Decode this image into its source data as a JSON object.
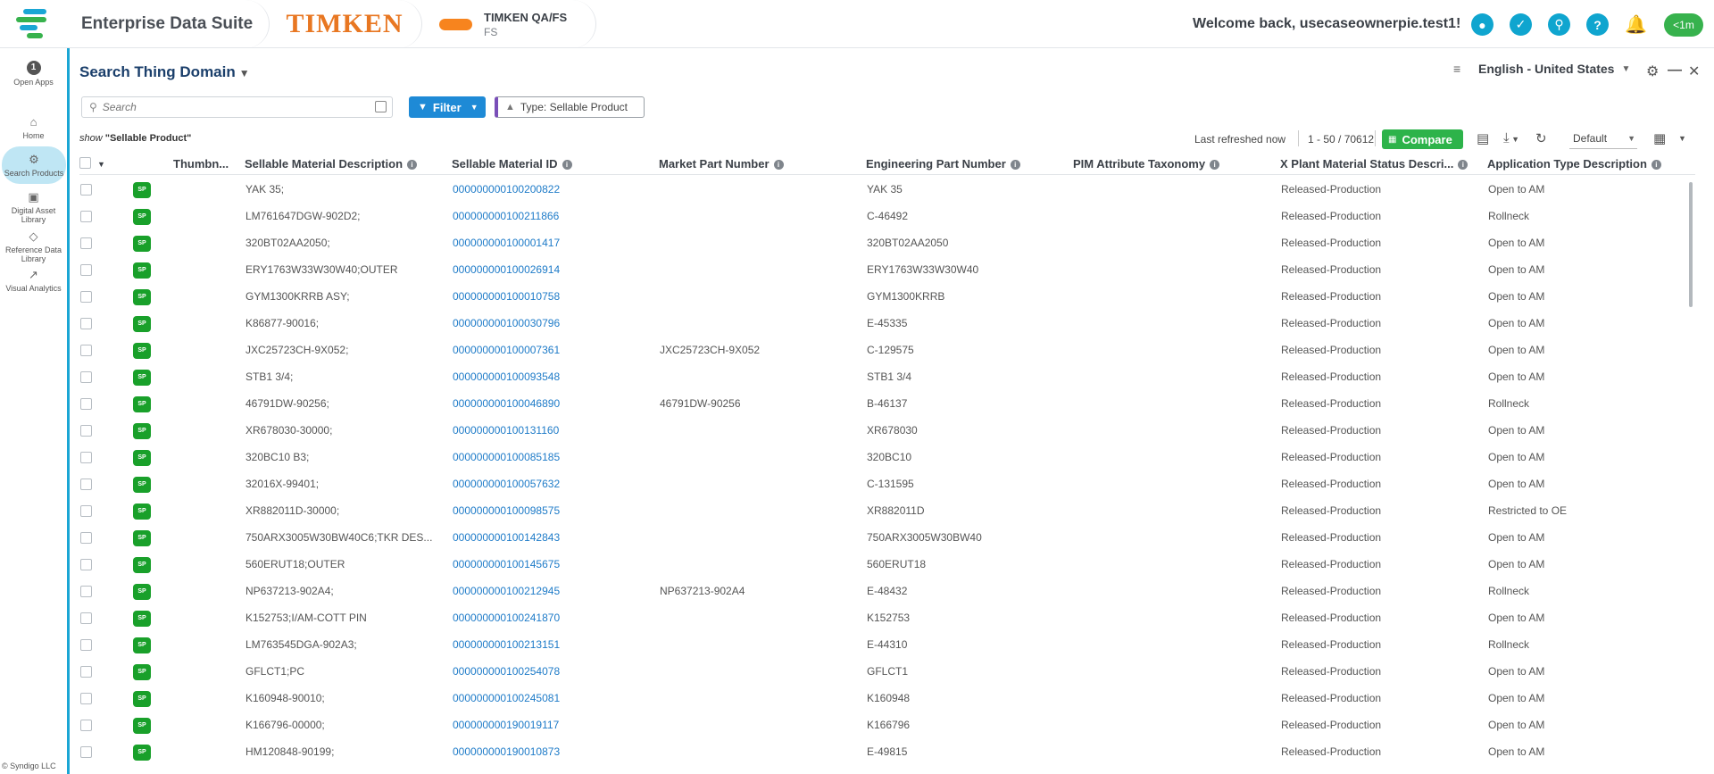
{
  "header": {
    "app_title": "Enterprise Data Suite",
    "brand": "TIMKEN",
    "tenant_name": "TIMKEN QA/FS",
    "tenant_sub": "FS",
    "welcome": "Welcome back,  usecaseownerpie.test1!",
    "last_active": "<1m"
  },
  "rail": {
    "open_apps_count": "1",
    "open_apps_label": "Open Apps",
    "items": [
      {
        "label": "Home",
        "icon": "home-icon"
      },
      {
        "label": "Search Products",
        "icon": "search-products-icon"
      },
      {
        "label": "Digital Asset Library",
        "icon": "image-icon"
      },
      {
        "label": "Reference Data Library",
        "icon": "tag-icon"
      },
      {
        "label": "Visual Analytics",
        "icon": "chart-icon"
      }
    ],
    "copyright": "© Syndigo LLC"
  },
  "page": {
    "title": "Search Thing Domain",
    "language": "English - United States",
    "search_placeholder": "Search",
    "filter_label": "Filter",
    "type_chip": "Type: Sellable Product",
    "show_prefix": "show",
    "show_value": "\"Sellable Product\"",
    "last_refreshed": "Last refreshed now",
    "range": "1 - 50 / 70612",
    "compare_label": "Compare",
    "view": "Default"
  },
  "grid": {
    "columns": [
      "Thumbn...",
      "Sellable Material Description",
      "Sellable Material ID",
      "Market Part Number",
      "Engineering Part Number",
      "PIM Attribute Taxonomy",
      "X Plant Material Status Descri...",
      "Application Type Description"
    ],
    "badge": "SP",
    "rows": [
      {
        "desc": "YAK 35;",
        "id": "000000000100200822",
        "mpn": "",
        "epn": "YAK 35",
        "tax": "",
        "status": "Released-Production",
        "app": "Open to AM"
      },
      {
        "desc": "LM761647DGW-902D2;",
        "id": "000000000100211866",
        "mpn": "",
        "epn": "C-46492",
        "tax": "",
        "status": "Released-Production",
        "app": "Rollneck"
      },
      {
        "desc": "320BT02AA2050;",
        "id": "000000000100001417",
        "mpn": "",
        "epn": "320BT02AA2050",
        "tax": "",
        "status": "Released-Production",
        "app": "Open to AM"
      },
      {
        "desc": "ERY1763W33W30W40;OUTER",
        "id": "000000000100026914",
        "mpn": "",
        "epn": "ERY1763W33W30W40",
        "tax": "",
        "status": "Released-Production",
        "app": "Open to AM"
      },
      {
        "desc": "GYM1300KRRB ASY;",
        "id": "000000000100010758",
        "mpn": "",
        "epn": "GYM1300KRRB",
        "tax": "",
        "status": "Released-Production",
        "app": "Open to AM"
      },
      {
        "desc": "K86877-90016;",
        "id": "000000000100030796",
        "mpn": "",
        "epn": "E-45335",
        "tax": "",
        "status": "Released-Production",
        "app": "Open to AM"
      },
      {
        "desc": "JXC25723CH-9X052;",
        "id": "000000000100007361",
        "mpn": "JXC25723CH-9X052",
        "epn": "C-129575",
        "tax": "",
        "status": "Released-Production",
        "app": "Open to AM"
      },
      {
        "desc": "STB1 3/4;",
        "id": "000000000100093548",
        "mpn": "",
        "epn": "STB1 3/4",
        "tax": "",
        "status": "Released-Production",
        "app": "Open to AM"
      },
      {
        "desc": "46791DW-90256;",
        "id": "000000000100046890",
        "mpn": "46791DW-90256",
        "epn": "B-46137",
        "tax": "",
        "status": "Released-Production",
        "app": "Rollneck"
      },
      {
        "desc": "XR678030-30000;",
        "id": "000000000100131160",
        "mpn": "",
        "epn": "XR678030",
        "tax": "",
        "status": "Released-Production",
        "app": "Open to AM"
      },
      {
        "desc": "320BC10 B3;",
        "id": "000000000100085185",
        "mpn": "",
        "epn": "320BC10",
        "tax": "",
        "status": "Released-Production",
        "app": "Open to AM"
      },
      {
        "desc": "32016X-99401;",
        "id": "000000000100057632",
        "mpn": "",
        "epn": "C-131595",
        "tax": "",
        "status": "Released-Production",
        "app": "Open to AM"
      },
      {
        "desc": "XR882011D-30000;",
        "id": "000000000100098575",
        "mpn": "",
        "epn": "XR882011D",
        "tax": "",
        "status": "Released-Production",
        "app": "Restricted to OE"
      },
      {
        "desc": "750ARX3005W30BW40C6;TKR DES...",
        "id": "000000000100142843",
        "mpn": "",
        "epn": "750ARX3005W30BW40",
        "tax": "",
        "status": "Released-Production",
        "app": "Open to AM"
      },
      {
        "desc": "560ERUT18;OUTER",
        "id": "000000000100145675",
        "mpn": "",
        "epn": "560ERUT18",
        "tax": "",
        "status": "Released-Production",
        "app": "Open to AM"
      },
      {
        "desc": "NP637213-902A4;",
        "id": "000000000100212945",
        "mpn": "NP637213-902A4",
        "epn": "E-48432",
        "tax": "",
        "status": "Released-Production",
        "app": "Rollneck"
      },
      {
        "desc": "K152753;I/AM-COTT PIN",
        "id": "000000000100241870",
        "mpn": "",
        "epn": "K152753",
        "tax": "",
        "status": "Released-Production",
        "app": "Open to AM"
      },
      {
        "desc": "LM763545DGA-902A3;",
        "id": "000000000100213151",
        "mpn": "",
        "epn": "E-44310",
        "tax": "",
        "status": "Released-Production",
        "app": "Rollneck"
      },
      {
        "desc": "GFLCT1;PC",
        "id": "000000000100254078",
        "mpn": "",
        "epn": "GFLCT1",
        "tax": "",
        "status": "Released-Production",
        "app": "Open to AM"
      },
      {
        "desc": "K160948-90010;",
        "id": "000000000100245081",
        "mpn": "",
        "epn": "K160948",
        "tax": "",
        "status": "Released-Production",
        "app": "Open to AM"
      },
      {
        "desc": "K166796-00000;",
        "id": "000000000190019117",
        "mpn": "",
        "epn": "K166796",
        "tax": "",
        "status": "Released-Production",
        "app": "Open to AM"
      },
      {
        "desc": "HM120848-90199;",
        "id": "000000000190010873",
        "mpn": "",
        "epn": "E-49815",
        "tax": "",
        "status": "Released-Production",
        "app": "Open to AM"
      }
    ]
  }
}
